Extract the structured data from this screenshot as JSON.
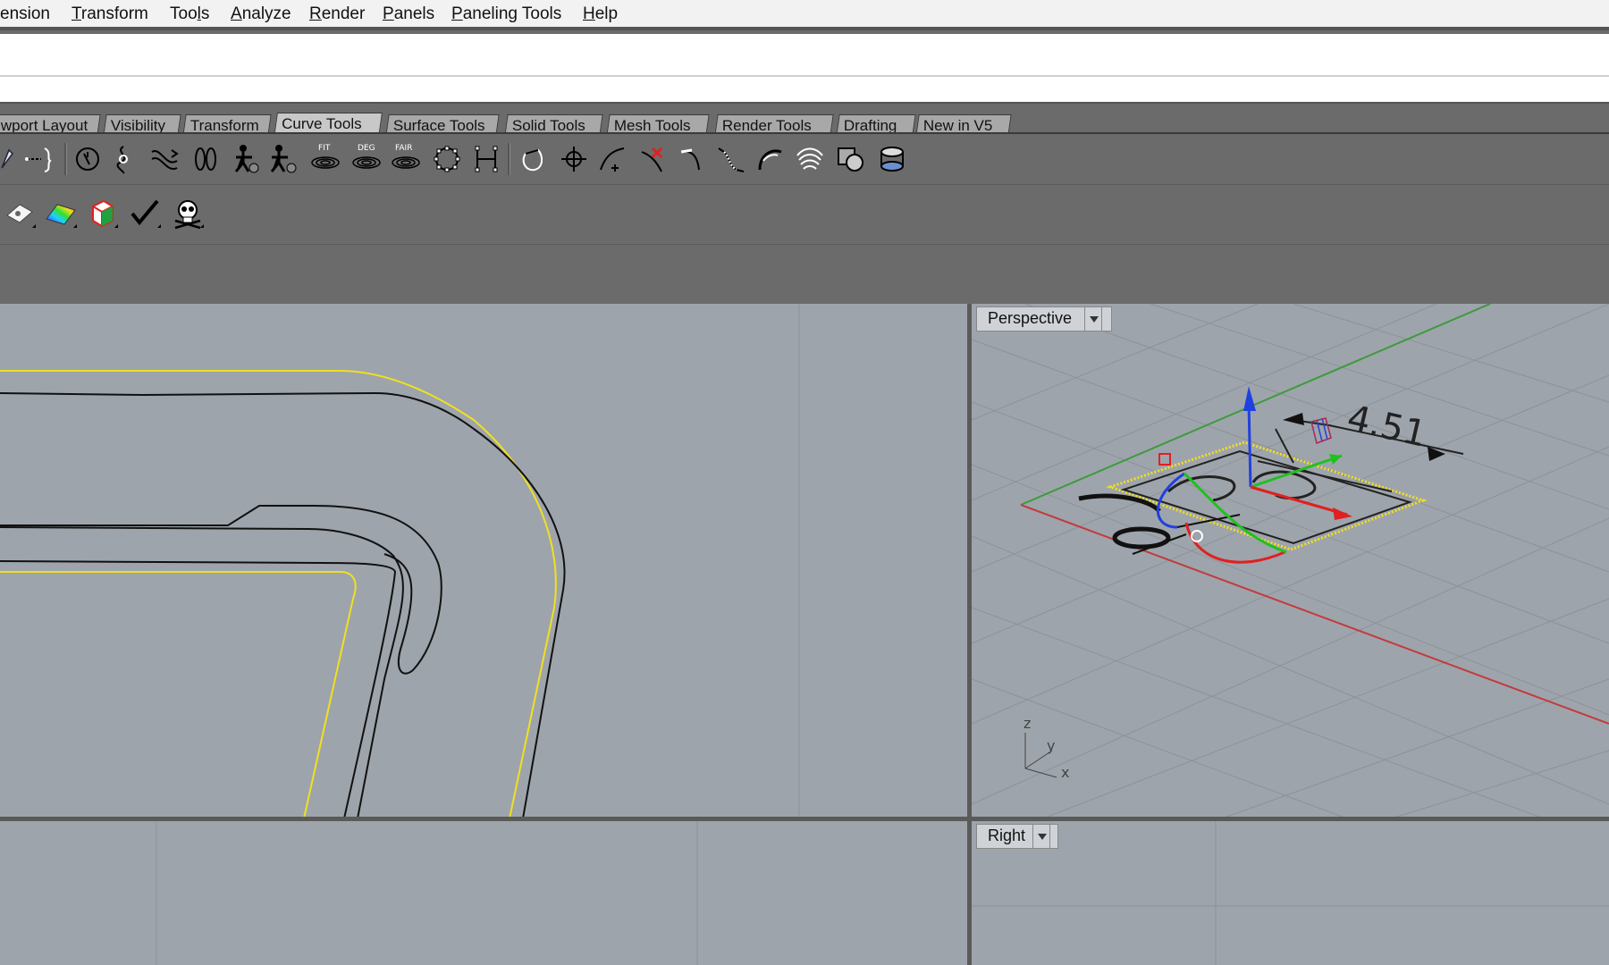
{
  "menu": {
    "items": [
      {
        "label": "ension",
        "accel": ""
      },
      {
        "label": "ransform",
        "accel": "T"
      },
      {
        "label": "Too",
        "accel": "l",
        "suffix": "s"
      },
      {
        "label": "nalyze",
        "accel": "A"
      },
      {
        "label": "ender",
        "accel": "R"
      },
      {
        "label": "anels",
        "accel": "P"
      },
      {
        "label": "aneling Tools",
        "accel": "P"
      },
      {
        "label": "elp",
        "accel": "H"
      }
    ]
  },
  "command": {
    "input_value": ""
  },
  "tabs": [
    {
      "label": "wport Layout"
    },
    {
      "label": "Visibility"
    },
    {
      "label": "Transform"
    },
    {
      "label": "Curve Tools"
    },
    {
      "label": "Surface Tools"
    },
    {
      "label": "Solid Tools"
    },
    {
      "label": "Mesh Tools"
    },
    {
      "label": "Render Tools"
    },
    {
      "label": "Drafting"
    },
    {
      "label": "New in V5"
    }
  ],
  "toolbar_row1": {
    "icons": [
      "curve-edit-icon",
      "point-curve-icon",
      "rebuild-icon",
      "insert-knot-icon",
      "adjust-seam-icon",
      "change-degree-icon",
      "match-curve-icon",
      "fair-curve-icon",
      "fit-curve-icon",
      "change-degree-deg-icon",
      "fair-icon",
      "control-points-icon",
      "weight-icon",
      "closed-curve-icon",
      "point-on-curve-icon",
      "curve-add-point-icon",
      "trim-curve-icon",
      "extend-curve-icon",
      "blend-curve-icon",
      "arc-blend-icon",
      "offset-curves-icon",
      "curve-boolean-icon",
      "extract-isocurve-icon"
    ],
    "labels": {
      "fit": "FIT",
      "deg": "DEG",
      "fair": "FAIR"
    }
  },
  "toolbar_row2": {
    "icons": [
      "draft-angle-icon",
      "zebra-analysis-icon",
      "edge-analysis-icon",
      "check-objects-icon",
      "skull-audit-icon"
    ]
  },
  "viewports": {
    "top": {
      "label": ""
    },
    "perspective": {
      "label": "Perspective"
    },
    "front": {
      "label": ""
    },
    "right": {
      "label": "Right"
    }
  },
  "perspective_scene": {
    "dimension_text": "4.51",
    "axis_labels": {
      "z": "z",
      "y": "y",
      "x": "x"
    }
  },
  "colors": {
    "viewport_bg": "#9ea4ab",
    "gridline": "#8c9298",
    "x_axis": "#c23c3c",
    "y_axis": "#3c9b3c",
    "selection": "#f0e020",
    "gumball_x": "#e02020",
    "gumball_y": "#20c020",
    "gumball_z": "#2040e0"
  }
}
